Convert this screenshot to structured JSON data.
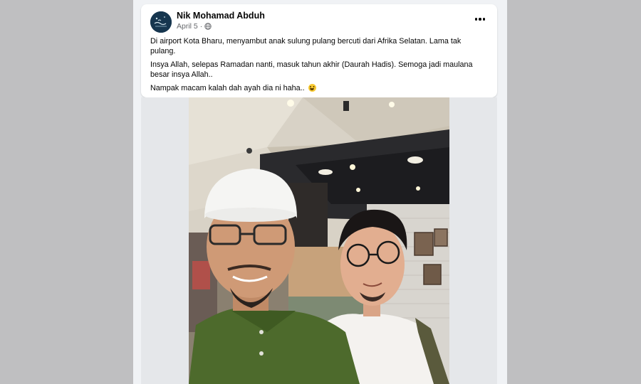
{
  "post": {
    "author": "Nik Mohamad Abduh",
    "date": "April 5",
    "separator": "·",
    "privacy_icon": "globe-icon",
    "more_icon": "more-options-icon",
    "paragraphs": [
      "Di airport Kota Bharu, menyambut anak sulung pulang bercuti dari Afrika Selatan. Lama tak pulang.",
      "Insya Allah, selepas Ramadan nanti, masuk tahun akhir (Daurah Hadis). Semoga jadi maulana besar insya Allah..",
      "Nampak macam kalah dah ayah dia ni haha.."
    ],
    "emoji": "grinning-face-emoji"
  },
  "colors": {
    "background": "#bfbfc1",
    "card": "#ffffff",
    "text": "#050505",
    "meta": "#65676b"
  }
}
